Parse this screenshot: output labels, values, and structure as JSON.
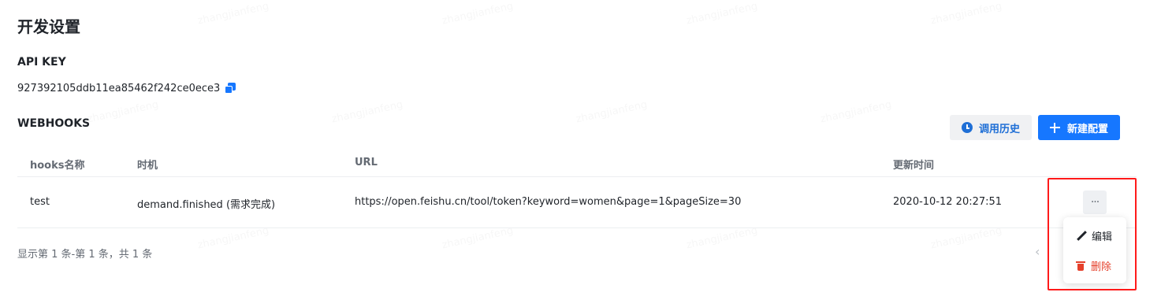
{
  "page_title": "开发设置",
  "api_key": {
    "title": "API KEY",
    "value": "927392105ddb11ea85462f242ce0ece3",
    "copy_icon": "copy-icon"
  },
  "webhooks": {
    "title": "WEBHOOKS",
    "history_button": "调用历史",
    "new_button": "新建配置",
    "columns": [
      "hooks名称",
      "时机",
      "URL",
      "更新时间"
    ],
    "rows": [
      {
        "name": "test",
        "trigger": "demand.finished (需求完成)",
        "url": "https://open.feishu.cn/tool/token?keyword=women&page=1&pageSize=30",
        "updated_at": "2020-10-12 20:27:51"
      }
    ],
    "more_button": "···",
    "menu": {
      "edit": "编辑",
      "delete": "删除"
    },
    "pagination": "显示第 1 条-第 1 条，共 1 条",
    "prev_icon": "chevron-left-icon"
  },
  "colors": {
    "primary": "#1677ff",
    "danger": "#e5402b",
    "highlight": "#ff1a1a"
  },
  "watermark": "zhangjianfeng"
}
